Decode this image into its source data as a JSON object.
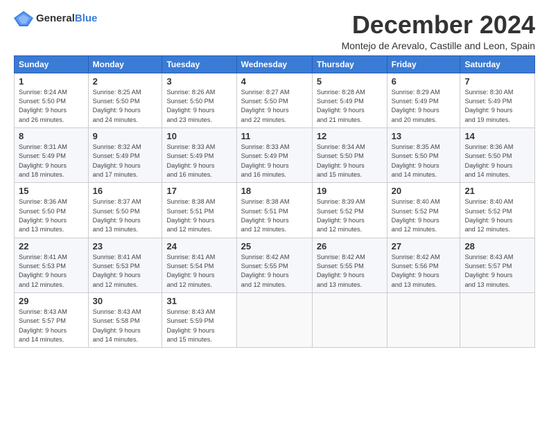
{
  "logo": {
    "general": "General",
    "blue": "Blue"
  },
  "title": "December 2024",
  "location": "Montejo de Arevalo, Castille and Leon, Spain",
  "weekdays": [
    "Sunday",
    "Monday",
    "Tuesday",
    "Wednesday",
    "Thursday",
    "Friday",
    "Saturday"
  ],
  "weeks": [
    [
      {
        "day": "1",
        "info": "Sunrise: 8:24 AM\nSunset: 5:50 PM\nDaylight: 9 hours\nand 26 minutes."
      },
      {
        "day": "2",
        "info": "Sunrise: 8:25 AM\nSunset: 5:50 PM\nDaylight: 9 hours\nand 24 minutes."
      },
      {
        "day": "3",
        "info": "Sunrise: 8:26 AM\nSunset: 5:50 PM\nDaylight: 9 hours\nand 23 minutes."
      },
      {
        "day": "4",
        "info": "Sunrise: 8:27 AM\nSunset: 5:50 PM\nDaylight: 9 hours\nand 22 minutes."
      },
      {
        "day": "5",
        "info": "Sunrise: 8:28 AM\nSunset: 5:49 PM\nDaylight: 9 hours\nand 21 minutes."
      },
      {
        "day": "6",
        "info": "Sunrise: 8:29 AM\nSunset: 5:49 PM\nDaylight: 9 hours\nand 20 minutes."
      },
      {
        "day": "7",
        "info": "Sunrise: 8:30 AM\nSunset: 5:49 PM\nDaylight: 9 hours\nand 19 minutes."
      }
    ],
    [
      {
        "day": "8",
        "info": "Sunrise: 8:31 AM\nSunset: 5:49 PM\nDaylight: 9 hours\nand 18 minutes."
      },
      {
        "day": "9",
        "info": "Sunrise: 8:32 AM\nSunset: 5:49 PM\nDaylight: 9 hours\nand 17 minutes."
      },
      {
        "day": "10",
        "info": "Sunrise: 8:33 AM\nSunset: 5:49 PM\nDaylight: 9 hours\nand 16 minutes."
      },
      {
        "day": "11",
        "info": "Sunrise: 8:33 AM\nSunset: 5:49 PM\nDaylight: 9 hours\nand 16 minutes."
      },
      {
        "day": "12",
        "info": "Sunrise: 8:34 AM\nSunset: 5:50 PM\nDaylight: 9 hours\nand 15 minutes."
      },
      {
        "day": "13",
        "info": "Sunrise: 8:35 AM\nSunset: 5:50 PM\nDaylight: 9 hours\nand 14 minutes."
      },
      {
        "day": "14",
        "info": "Sunrise: 8:36 AM\nSunset: 5:50 PM\nDaylight: 9 hours\nand 14 minutes."
      }
    ],
    [
      {
        "day": "15",
        "info": "Sunrise: 8:36 AM\nSunset: 5:50 PM\nDaylight: 9 hours\nand 13 minutes."
      },
      {
        "day": "16",
        "info": "Sunrise: 8:37 AM\nSunset: 5:50 PM\nDaylight: 9 hours\nand 13 minutes."
      },
      {
        "day": "17",
        "info": "Sunrise: 8:38 AM\nSunset: 5:51 PM\nDaylight: 9 hours\nand 12 minutes."
      },
      {
        "day": "18",
        "info": "Sunrise: 8:38 AM\nSunset: 5:51 PM\nDaylight: 9 hours\nand 12 minutes."
      },
      {
        "day": "19",
        "info": "Sunrise: 8:39 AM\nSunset: 5:52 PM\nDaylight: 9 hours\nand 12 minutes."
      },
      {
        "day": "20",
        "info": "Sunrise: 8:40 AM\nSunset: 5:52 PM\nDaylight: 9 hours\nand 12 minutes."
      },
      {
        "day": "21",
        "info": "Sunrise: 8:40 AM\nSunset: 5:52 PM\nDaylight: 9 hours\nand 12 minutes."
      }
    ],
    [
      {
        "day": "22",
        "info": "Sunrise: 8:41 AM\nSunset: 5:53 PM\nDaylight: 9 hours\nand 12 minutes."
      },
      {
        "day": "23",
        "info": "Sunrise: 8:41 AM\nSunset: 5:53 PM\nDaylight: 9 hours\nand 12 minutes."
      },
      {
        "day": "24",
        "info": "Sunrise: 8:41 AM\nSunset: 5:54 PM\nDaylight: 9 hours\nand 12 minutes."
      },
      {
        "day": "25",
        "info": "Sunrise: 8:42 AM\nSunset: 5:55 PM\nDaylight: 9 hours\nand 12 minutes."
      },
      {
        "day": "26",
        "info": "Sunrise: 8:42 AM\nSunset: 5:55 PM\nDaylight: 9 hours\nand 13 minutes."
      },
      {
        "day": "27",
        "info": "Sunrise: 8:42 AM\nSunset: 5:56 PM\nDaylight: 9 hours\nand 13 minutes."
      },
      {
        "day": "28",
        "info": "Sunrise: 8:43 AM\nSunset: 5:57 PM\nDaylight: 9 hours\nand 13 minutes."
      }
    ],
    [
      {
        "day": "29",
        "info": "Sunrise: 8:43 AM\nSunset: 5:57 PM\nDaylight: 9 hours\nand 14 minutes."
      },
      {
        "day": "30",
        "info": "Sunrise: 8:43 AM\nSunset: 5:58 PM\nDaylight: 9 hours\nand 14 minutes."
      },
      {
        "day": "31",
        "info": "Sunrise: 8:43 AM\nSunset: 5:59 PM\nDaylight: 9 hours\nand 15 minutes."
      },
      {
        "day": "",
        "info": ""
      },
      {
        "day": "",
        "info": ""
      },
      {
        "day": "",
        "info": ""
      },
      {
        "day": "",
        "info": ""
      }
    ]
  ]
}
